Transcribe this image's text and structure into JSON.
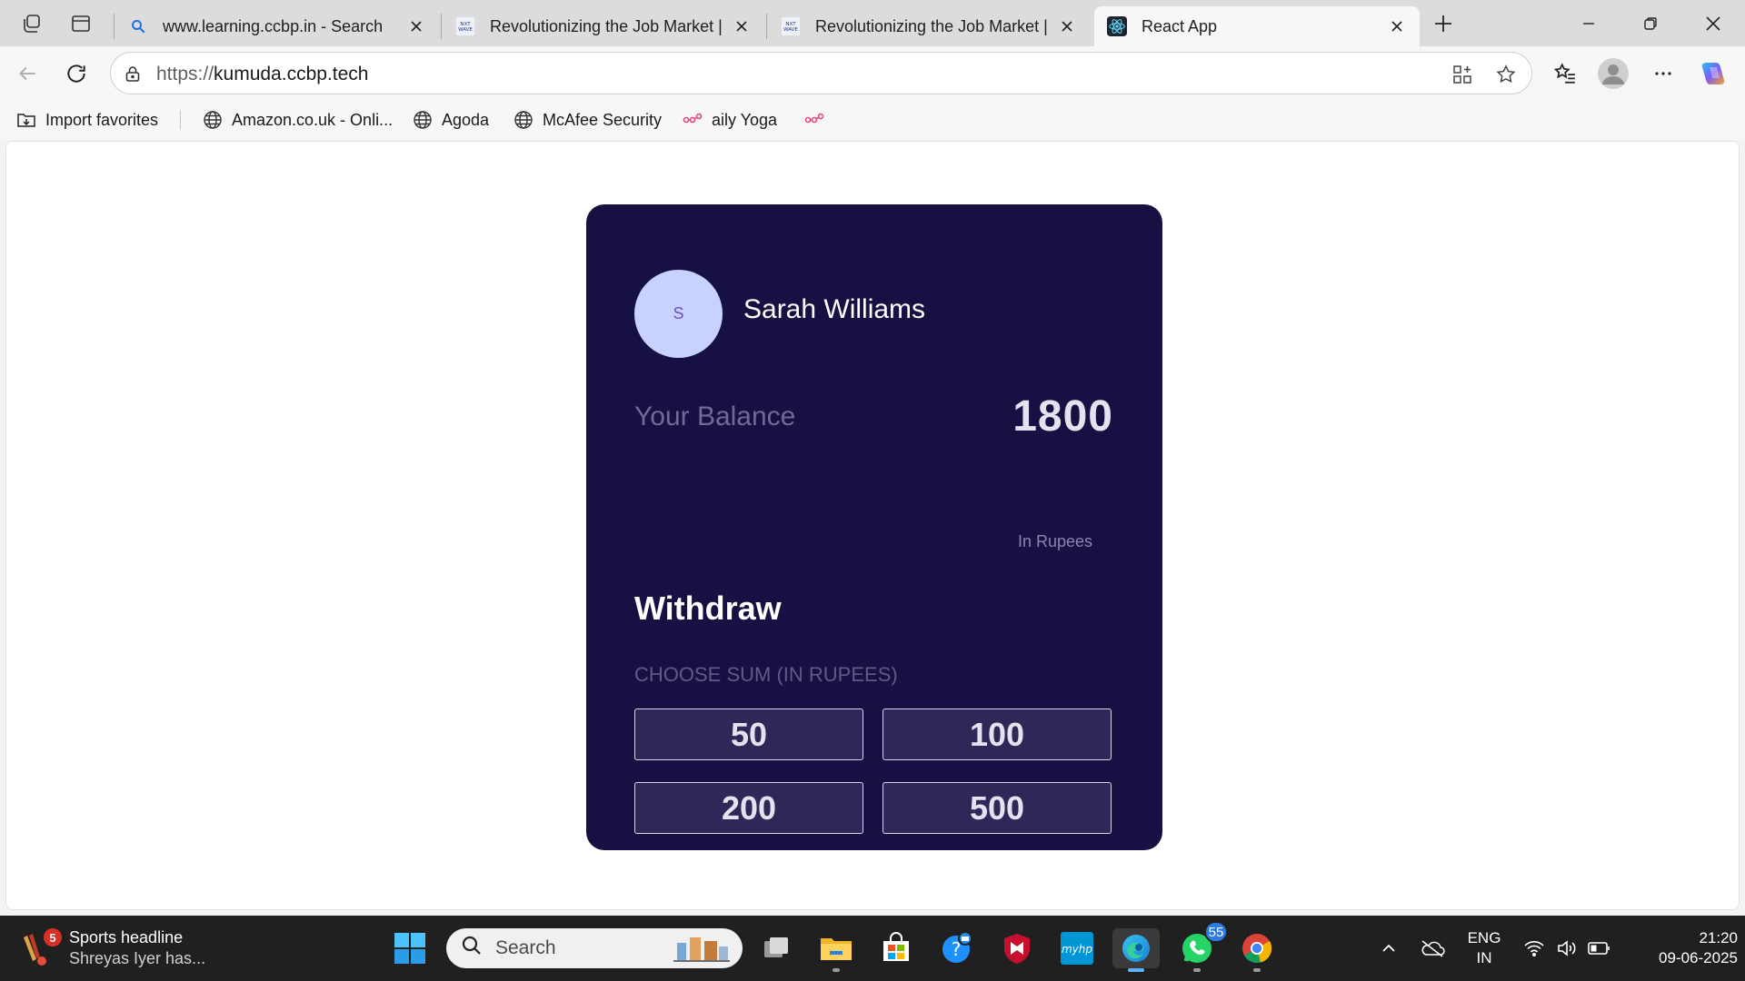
{
  "browser": {
    "tabs": [
      {
        "title": "www.learning.ccbp.in - Search",
        "favicon": "search-icon"
      },
      {
        "title": "Revolutionizing the Job Market | NxtWave",
        "favicon": "nxtwave-icon"
      },
      {
        "title": "Revolutionizing the Job Market | NxtWave",
        "favicon": "nxtwave-icon"
      },
      {
        "title": "React App",
        "favicon": "react-icon",
        "active": true
      }
    ],
    "url_scheme": "https://",
    "url_host": "kumuda.ccbp.tech",
    "bookmarks": [
      {
        "label": "Import favorites",
        "icon": "import-icon"
      },
      {
        "label": "Amazon.co.uk - Onli...",
        "icon": "globe-icon"
      },
      {
        "label": "Agoda",
        "icon": "globe-icon"
      },
      {
        "label": "McAfee Security",
        "icon": "globe-icon"
      },
      {
        "label": "aily Yoga",
        "icon": "link-icon"
      },
      {
        "label": "",
        "icon": "link-icon"
      }
    ]
  },
  "app": {
    "avatar_initial": "S",
    "user_name": "Sarah Williams",
    "balance_label": "Your Balance",
    "balance_amount": "1800",
    "balance_unit": "In Rupees",
    "withdraw_heading": "Withdraw",
    "choose_label": "CHOOSE SUM (IN RUPEES)",
    "denominations": [
      "50",
      "100",
      "200",
      "500"
    ],
    "colors": {
      "card_bg": "#171043",
      "button_bg": "#2f2758",
      "avatar_bg": "#c7d2fe"
    }
  },
  "taskbar": {
    "news_badge": "5",
    "news_title": "Sports headline",
    "news_subtitle": "Shreyas Iyer has...",
    "search_placeholder": "Search",
    "whatsapp_badge": "55",
    "lang_top": "ENG",
    "lang_bottom": "IN",
    "time": "21:20",
    "date": "09-06-2025"
  }
}
